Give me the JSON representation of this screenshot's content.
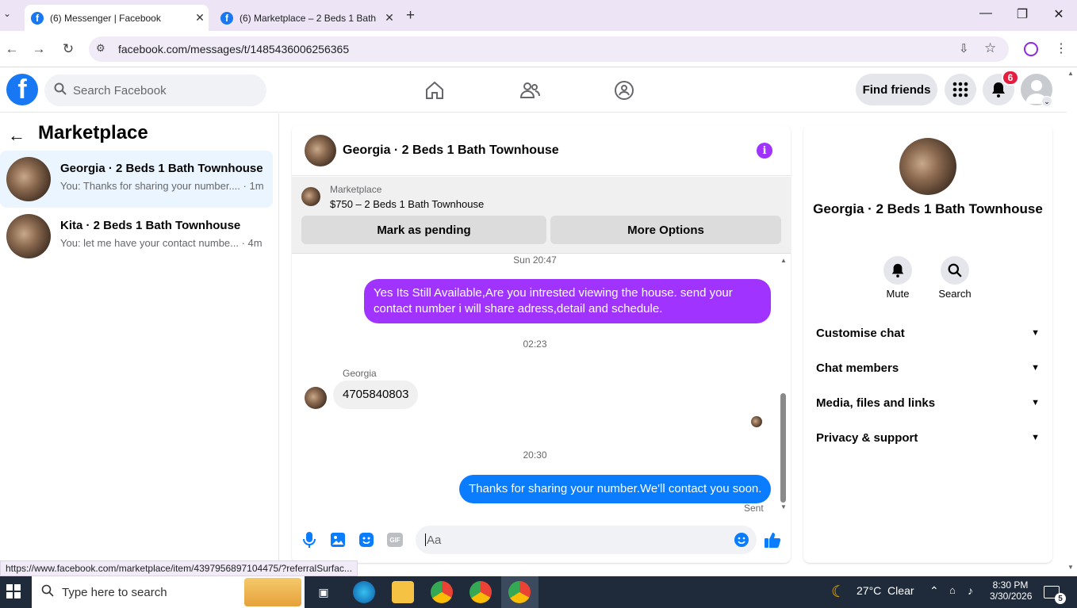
{
  "browser": {
    "tabs": [
      {
        "title": "(6) Messenger | Facebook",
        "active": true
      },
      {
        "title": "(6) Marketplace – 2 Beds 1 Bath",
        "active": false
      }
    ],
    "url": "facebook.com/messages/t/1485436006256365",
    "status_url": "https://www.facebook.com/marketplace/item/4397956897104475/?referralSurfac..."
  },
  "header": {
    "logo": "f",
    "search_placeholder": "Search Facebook",
    "find_friends": "Find friends",
    "notification_count": "6"
  },
  "left": {
    "title": "Marketplace",
    "conversations": [
      {
        "name": "Georgia · 2 Beds 1 Bath Townhouse",
        "preview": "You: Thanks for sharing your number.... · 1m",
        "selected": true
      },
      {
        "name": "Kita · 2 Beds 1 Bath Townhouse",
        "preview": "You: let me have your contact numbe... · 4m",
        "selected": false
      }
    ]
  },
  "chat": {
    "title": "Georgia · 2 Beds 1 Bath Townhouse",
    "marketplace_label": "Marketplace",
    "listing": "$750 – 2 Beds 1 Bath Townhouse",
    "mark_pending": "Mark as pending",
    "more_options": "More Options",
    "messages": {
      "ts1": "Sun 20:47",
      "msg1": "Yes Its Still Available,Are you intrested viewing the house. send your contact number i will share adress,detail and schedule.",
      "ts2": "02:23",
      "sender": "Georgia",
      "msg2": "4705840803",
      "ts3": "20:30",
      "msg3": "Thanks for sharing your number.We'll contact you soon.",
      "sent": "Sent"
    },
    "input_placeholder": "Aa"
  },
  "right": {
    "name": "Georgia · 2 Beds 1 Bath Townhouse",
    "mute": "Mute",
    "search": "Search",
    "sections": [
      "Customise chat",
      "Chat members",
      "Media, files and links",
      "Privacy & support"
    ]
  },
  "taskbar": {
    "search": "Type here to search",
    "weather": "27°C  Clear",
    "time": "8:30 PM",
    "date": "3/30/2026",
    "notif": "5"
  },
  "colors": {
    "fb_blue": "#1877f2",
    "purple": "#a033ff",
    "msg_blue": "#0a7cff"
  }
}
